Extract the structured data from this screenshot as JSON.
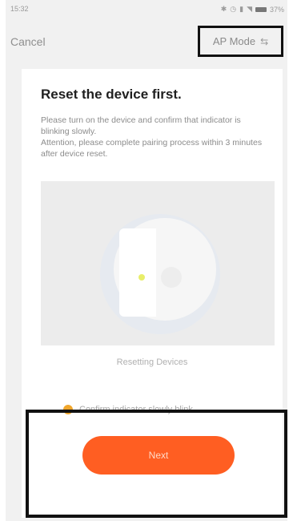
{
  "status_bar": {
    "time": "15:32",
    "icons": [
      "bluetooth-icon",
      "alarm-icon",
      "signal-icon",
      "wifi-icon",
      "battery-icon"
    ],
    "battery_percent": "37%"
  },
  "nav": {
    "cancel_label": "Cancel",
    "mode_label": "AP Mode",
    "mode_icon": "swap-icon"
  },
  "card": {
    "title": "Reset the device first.",
    "description": "Please turn on the device and confirm that indicator is blinking slowly.\nAttention, please complete pairing process within 3 minutes after device reset.",
    "illustration_caption": "Resetting Devices",
    "confirm_text": "Confirm indicator slowly blink",
    "next_label": "Next"
  },
  "colors": {
    "accent": "#ff5e22",
    "confirm_check": "#f0a62c",
    "indicator_led": "#e8ee6a"
  }
}
